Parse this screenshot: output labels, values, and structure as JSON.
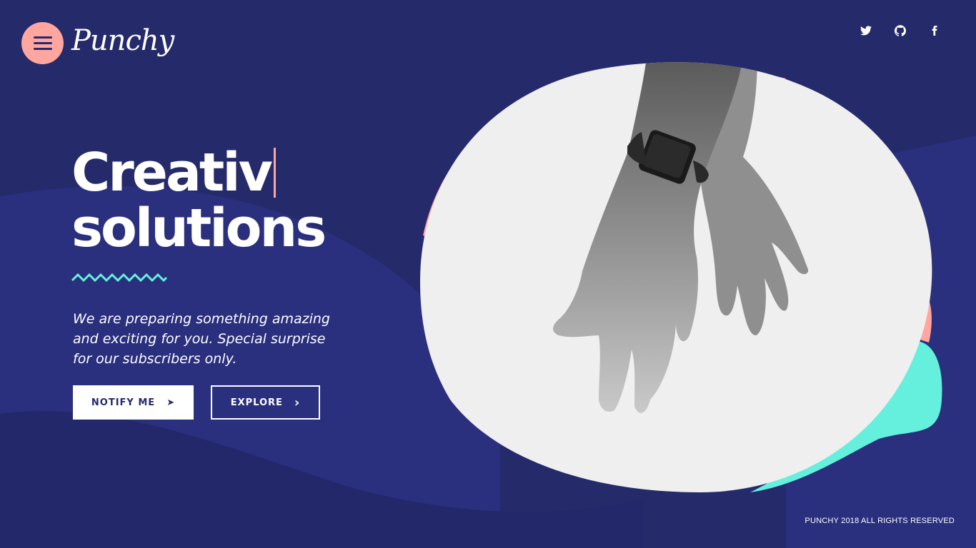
{
  "brand": {
    "name": "Punchy"
  },
  "header": {
    "menu_icon": "hamburger-menu-icon",
    "social": [
      {
        "name": "twitter",
        "icon": "twitter-icon"
      },
      {
        "name": "github",
        "icon": "github-icon"
      },
      {
        "name": "facebook",
        "icon": "facebook-icon"
      }
    ]
  },
  "hero": {
    "title_line1": "Creativ",
    "title_line2": "solutions",
    "lead": "We are preparing something amazing and exciting for you. Special surprise for our subscribers only.",
    "notify_label": "NOTIFY ME",
    "notify_arrow": "➤",
    "explore_label": "EXPLORE",
    "explore_arrow": "›"
  },
  "footer": {
    "copyright": "PUNCHY 2018 ALL RIGHTS RESERVED"
  },
  "colors": {
    "background": "#252a6b",
    "accent_pink": "#ffa69e",
    "accent_mint": "#64f0dc",
    "blob": "#efefef",
    "text": "#ffffff"
  }
}
